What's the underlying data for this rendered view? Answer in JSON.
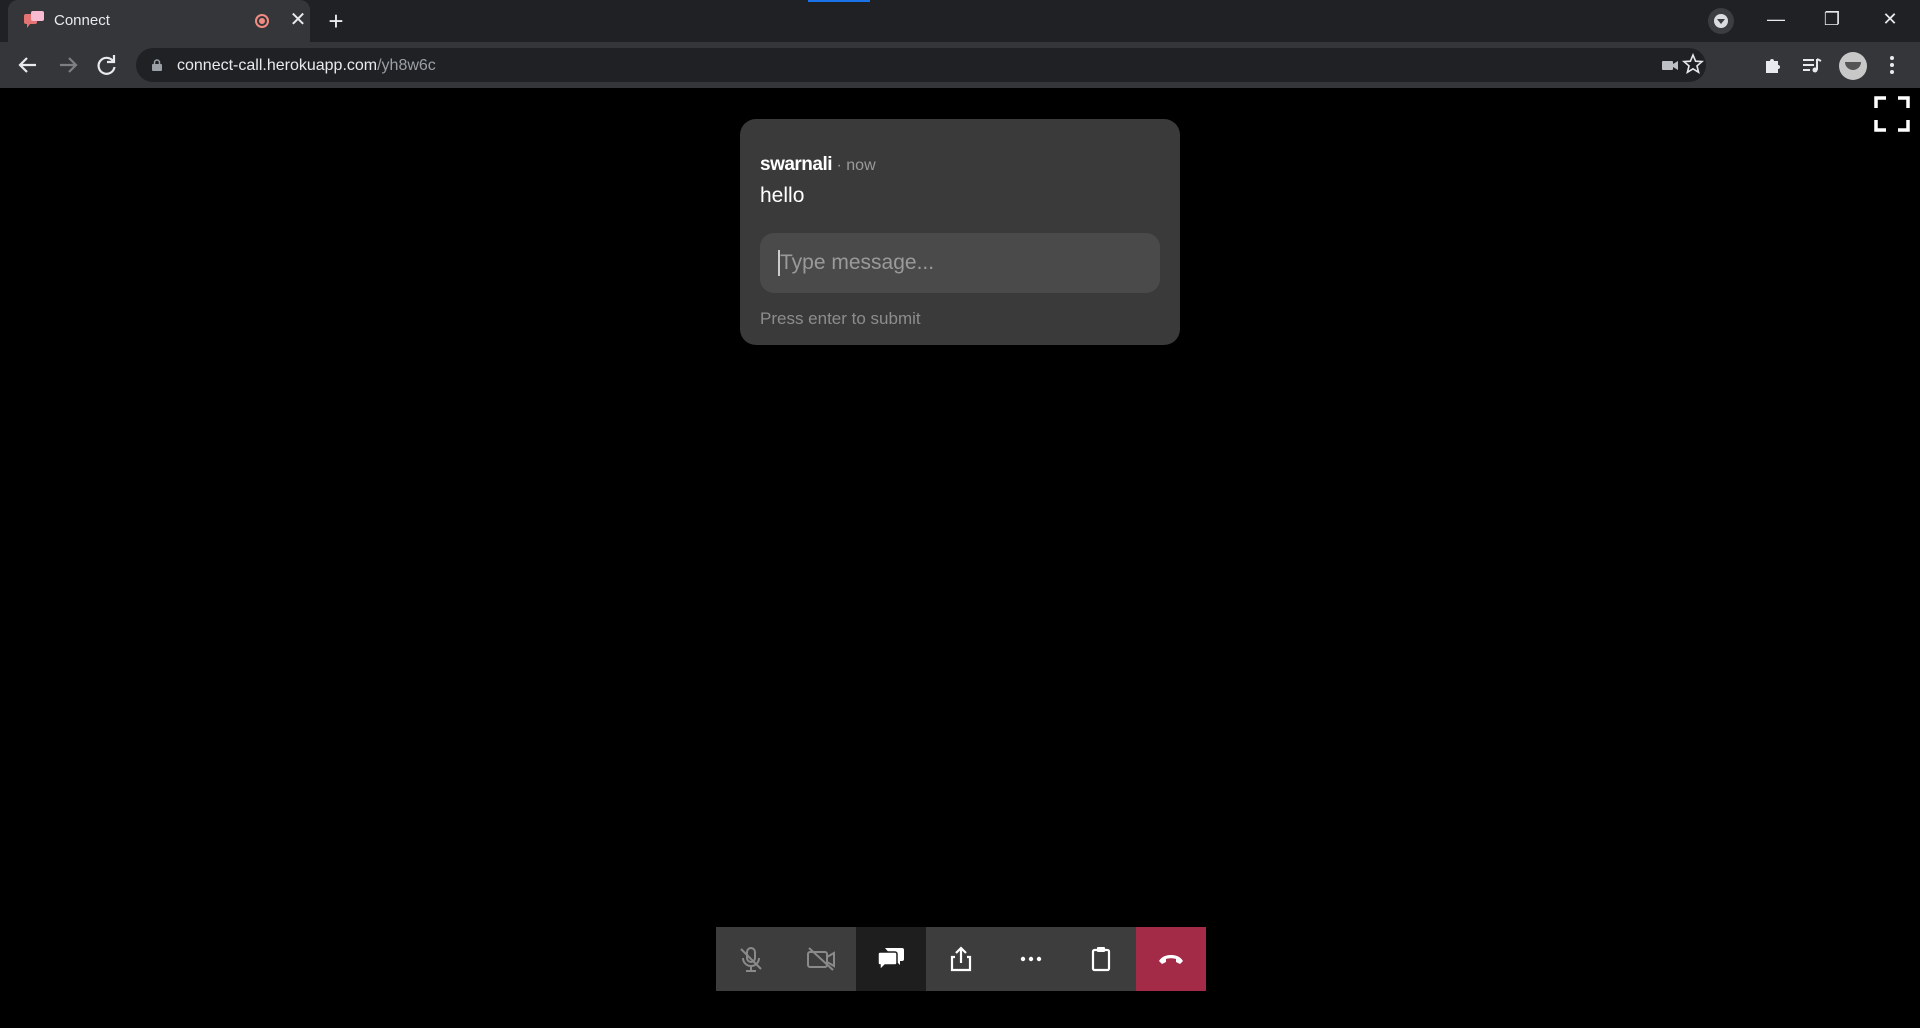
{
  "browser": {
    "tab_title": "Connect",
    "new_tab_glyph": "+",
    "tab_close_glyph": "✕",
    "url_host": "connect-call.herokuapp.com",
    "url_path": "/yh8w6c",
    "window_controls": {
      "minimize": "—",
      "restore": "❐",
      "close": "✕"
    }
  },
  "chat": {
    "sender": "swarnali",
    "separator": " · ",
    "time": "now",
    "message": "hello",
    "input_placeholder": "Type message...",
    "hint": "Press enter to submit"
  },
  "controls": {
    "items": [
      {
        "name": "mute-mic",
        "icon": "mic-off-icon",
        "state": "off"
      },
      {
        "name": "camera",
        "icon": "camera-off-icon",
        "state": "off"
      },
      {
        "name": "chat",
        "icon": "chat-icon",
        "state": "active"
      },
      {
        "name": "share-screen",
        "icon": "share-icon",
        "state": "on"
      },
      {
        "name": "more",
        "icon": "more-icon",
        "state": "on"
      },
      {
        "name": "copy-link",
        "icon": "clipboard-icon",
        "state": "on"
      },
      {
        "name": "end-call",
        "icon": "hang-up-icon",
        "state": "danger"
      }
    ]
  },
  "colors": {
    "end_call": "#a32b48",
    "card": "#3a3a3a",
    "recording": "#f28b82"
  }
}
